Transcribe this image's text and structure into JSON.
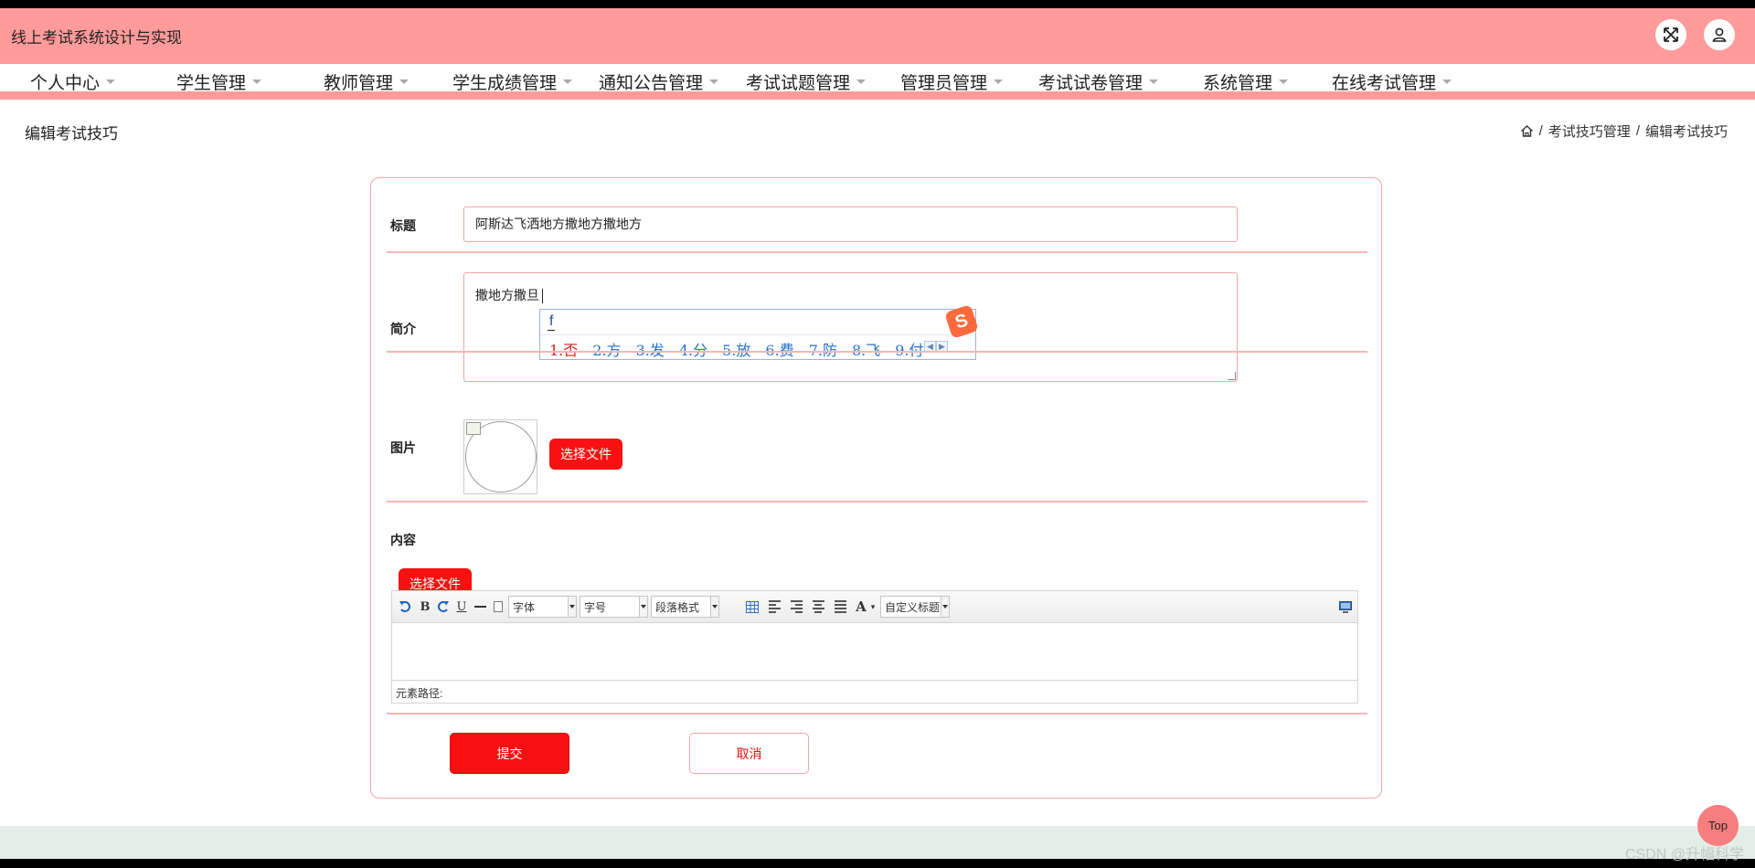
{
  "header": {
    "app_title": "线上考试系统设计与实现",
    "fullscreen_icon": "fullscreen-icon",
    "user_icon": "user-icon"
  },
  "nav": {
    "items": [
      "个人中心",
      "学生管理",
      "教师管理",
      "学生成绩管理",
      "通知公告管理",
      "考试试题管理",
      "管理员管理",
      "考试试卷管理",
      "系统管理",
      "在线考试管理"
    ]
  },
  "page": {
    "heading": "编辑考试技巧",
    "breadcrumb": [
      "考试技巧管理",
      "编辑考试技巧"
    ],
    "home_icon": "home-icon"
  },
  "form": {
    "title_label": "标题",
    "title_value": "阿斯达飞洒地方撒地方撒地方",
    "intro_label": "简介",
    "intro_value": "撒地方撒旦",
    "image_label": "图片",
    "image_button": "选择文件",
    "content_label": "内容",
    "content_button": "选择文件",
    "submit": "提交",
    "cancel": "取消"
  },
  "ime": {
    "input": "f",
    "candidates": [
      "1.否",
      "2.方",
      "3.发",
      "4.分",
      "5.放",
      "6.费",
      "7.防",
      "8.飞",
      "9.付"
    ],
    "logo": "S"
  },
  "editor": {
    "font_select": "字体",
    "size_select": "字号",
    "paragraph_select": "段落格式",
    "custom_heading_select": "自定义标题",
    "element_path": "元素路径:",
    "bold": "B",
    "underline": "U",
    "font_color": "A"
  },
  "footer": {
    "top_button": "Top",
    "watermark": "CSDN @升幅科学"
  },
  "colors": {
    "header_bg": "#ff9b9b",
    "accent_red": "#f91010",
    "border_pink": "#f3a5a5",
    "footer_bg": "#e2eee7"
  }
}
